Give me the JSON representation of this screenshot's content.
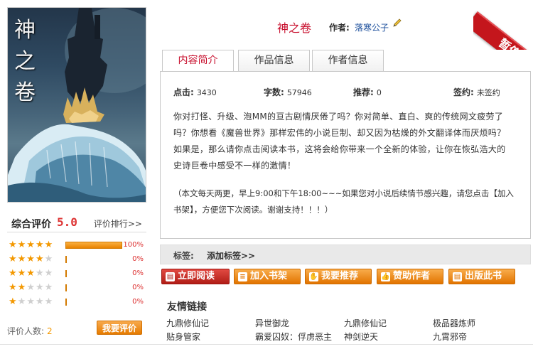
{
  "cover": {
    "title_chars": [
      "神",
      "之",
      "卷"
    ]
  },
  "rating": {
    "title": "综合评价",
    "score": "5.0",
    "rank_link": "评价排行>>",
    "rows": [
      {
        "stars": 5,
        "fraction": 1.0,
        "percent": "100%"
      },
      {
        "stars": 4,
        "fraction": 0.0,
        "percent": "0%"
      },
      {
        "stars": 3,
        "fraction": 0.0,
        "percent": "0%"
      },
      {
        "stars": 2,
        "fraction": 0.0,
        "percent": "0%"
      },
      {
        "stars": 1,
        "fraction": 0.0,
        "percent": "0%"
      }
    ],
    "raters_label": "评价人数:",
    "raters_count": "2",
    "rate_button": "我要评价"
  },
  "book": {
    "title": "神之卷",
    "author_label": "作者:",
    "author_name": "落寒公子",
    "status_badge": "暂停"
  },
  "tabs": [
    {
      "label": "内容简介",
      "active": true
    },
    {
      "label": "作品信息",
      "active": false
    },
    {
      "label": "作者信息",
      "active": false
    }
  ],
  "stats": {
    "clicks_label": "点击:",
    "clicks": "3430",
    "words_label": "字数:",
    "words": "57946",
    "recommend_label": "推荐:",
    "recommend": "0",
    "contract_label": "签约:",
    "contract": "未签约"
  },
  "intro": "你对打怪、升级、泡MM的亘古剧情厌倦了吗？你对简单、直白、爽的传统网文疲劳了吗？你想看《魔兽世界》那样宏伟的小说巨制、却又因为枯燥的外文翻译体而厌烦吗？如果是，那么请你点击阅读本书，这将会给你带来一个全新的体验，让你在恢弘浩大的史诗巨卷中感受不一样的激情！",
  "notice": "（本文每天两更，早上9:00和下午18:00~~~如果您对小说后续情节感兴趣，请您点击【加入书架】，方便您下次阅读。谢谢支持！！！）",
  "tags": {
    "label": "标签:",
    "add": "添加标签>>"
  },
  "actions": [
    {
      "label": "立即阅读",
      "icon": "book-icon",
      "style": "red"
    },
    {
      "label": "加入书架",
      "icon": "layers-icon",
      "style": "orange"
    },
    {
      "label": "我要推荐",
      "icon": "hand-icon",
      "style": "orange"
    },
    {
      "label": "赞助作者",
      "icon": "thumb-icon",
      "style": "orange"
    },
    {
      "label": "出版此书",
      "icon": "book-icon",
      "style": "orange"
    }
  ],
  "links": {
    "title": "友情链接",
    "items": [
      "九鼎修仙记",
      "异世御龙",
      "九鼎修仙记",
      "极品器炼师",
      "贴身管家",
      "霸爱囚奴：俘虏恶主",
      "神剑逆天",
      "九霄邪帝"
    ]
  }
}
